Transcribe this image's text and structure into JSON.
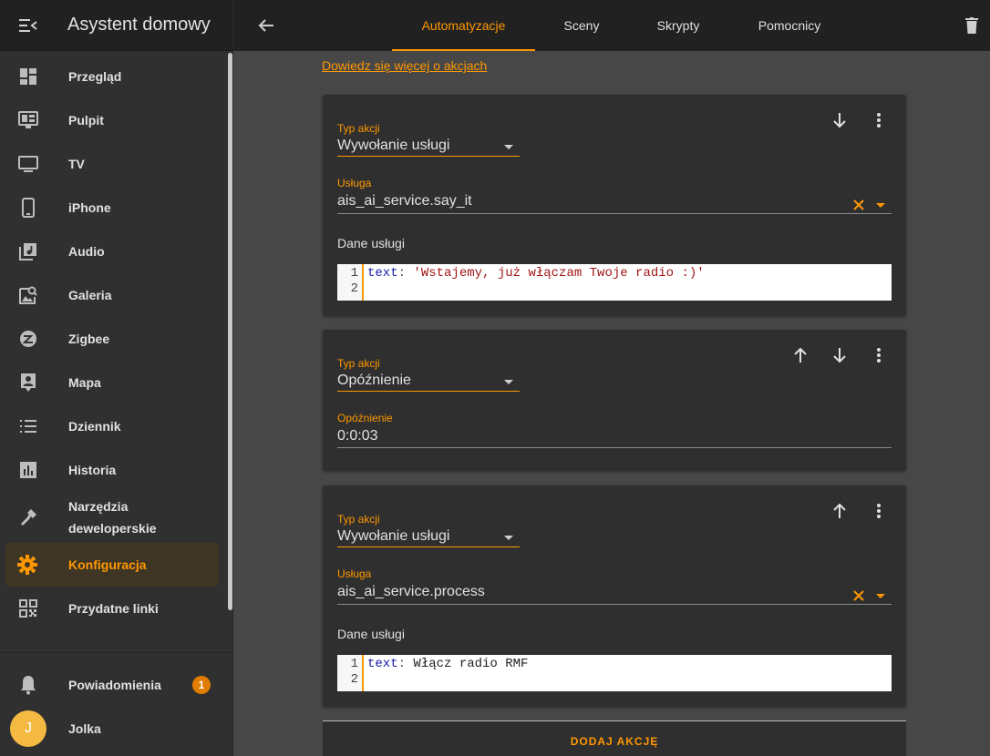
{
  "app": {
    "title": "Asystent domowy"
  },
  "sidebar": {
    "items": [
      {
        "label": "Przegląd",
        "icon": "dashboard-icon"
      },
      {
        "label": "Pulpit",
        "icon": "monitor-dashboard-icon"
      },
      {
        "label": "TV",
        "icon": "tv-icon"
      },
      {
        "label": "iPhone",
        "icon": "cellphone-icon"
      },
      {
        "label": "Audio",
        "icon": "music-library-icon"
      },
      {
        "label": "Galeria",
        "icon": "image-search-icon"
      },
      {
        "label": "Zigbee",
        "icon": "zigbee-icon"
      },
      {
        "label": "Mapa",
        "icon": "map-account-icon"
      },
      {
        "label": "Dziennik",
        "icon": "format-list-icon"
      },
      {
        "label": "Historia",
        "icon": "chart-box-icon"
      },
      {
        "label": "Narzędzia deweloperskie",
        "label_line1": "Narzędzia",
        "label_line2": "deweloperskie",
        "icon": "hammer-icon"
      },
      {
        "label": "Konfiguracja",
        "icon": "gear-icon",
        "active": true
      },
      {
        "label": "Przydatne linki",
        "icon": "qrcode-icon"
      }
    ],
    "notifications": {
      "label": "Powiadomienia",
      "count": "1"
    },
    "user": {
      "name": "Jolka",
      "initial": "J"
    }
  },
  "topbar": {
    "tabs": [
      {
        "label": "Automatyzacje",
        "active": true
      },
      {
        "label": "Sceny"
      },
      {
        "label": "Skrypty"
      },
      {
        "label": "Pomocnicy"
      }
    ]
  },
  "content": {
    "learn_more": "Dowiedz się więcej o akcjach",
    "actions": [
      {
        "type_label": "Typ akcji",
        "type_value": "Wywołanie usługi",
        "service_label": "Usługa",
        "service_value": "ais_ai_service.say_it",
        "data_label": "Dane usługi",
        "code_key": "text",
        "code_value": "'Wstajemy, już włączam Twoje radio :)'",
        "lines": [
          "1",
          "2"
        ]
      },
      {
        "type_label": "Typ akcji",
        "type_value": "Opóźnienie",
        "delay_label": "Opóźnienie",
        "delay_value": "0:0:03"
      },
      {
        "type_label": "Typ akcji",
        "type_value": "Wywołanie usługi",
        "service_label": "Usługa",
        "service_value": "ais_ai_service.process",
        "data_label": "Dane usługi",
        "code_key": "text",
        "code_value": "Włącz radio RMF",
        "lines": [
          "1",
          "2"
        ]
      }
    ],
    "add_action": "DODAJ AKCJĘ"
  },
  "colors": {
    "accent": "#ff9800",
    "sidebar_bg": "#303030",
    "header_bg": "#212121",
    "card_bg": "#2f2f2f",
    "content_bg": "#474747"
  }
}
